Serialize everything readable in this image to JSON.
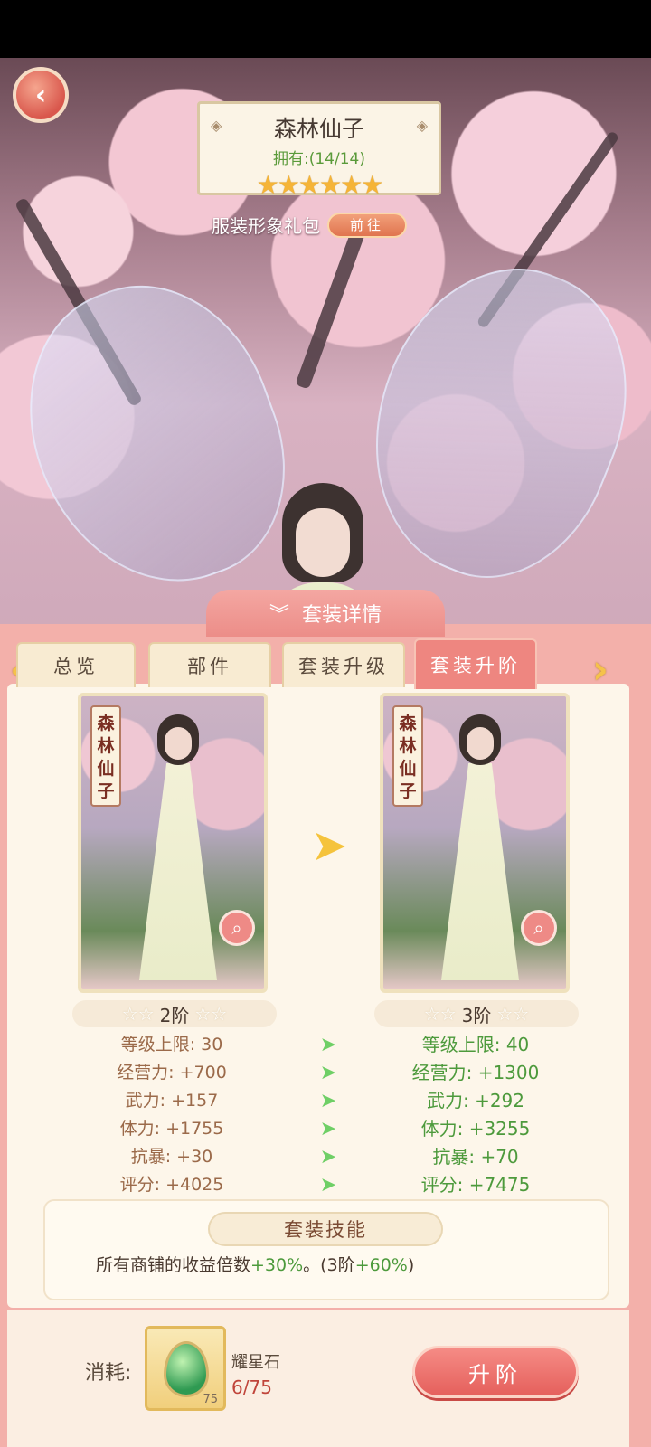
{
  "nameplate": {
    "title": "森林仙子",
    "owned": "拥有:(14/14)",
    "stars_filled": 6,
    "stars_glyphs": "★★★★★★"
  },
  "gift": {
    "label": "服装形象礼包",
    "button": "前往"
  },
  "panel": {
    "title": "套装详情"
  },
  "tabs": [
    {
      "label": "总览",
      "active": false
    },
    {
      "label": "部件",
      "active": false
    },
    {
      "label": "套装升级",
      "active": false
    },
    {
      "label": "套装升阶",
      "active": true
    }
  ],
  "cards": {
    "current": {
      "name_vertical": "森林仙子",
      "tier": "2阶"
    },
    "next": {
      "name_vertical": "森林仙子",
      "tier": "3阶"
    }
  },
  "stats": {
    "current": [
      "等级上限: 30",
      "经营力: +700",
      "武力: +157",
      "体力: +1755",
      "抗暴: +30",
      "评分: +4025"
    ],
    "next": [
      "等级上限: 40",
      "经营力: +1300",
      "武力: +292",
      "体力: +3255",
      "抗暴: +70",
      "评分: +7475"
    ]
  },
  "skill": {
    "title": "套装技能",
    "desc_prefix": "所有商铺的收益倍数",
    "desc_green": "+30%",
    "desc_mid": "。(3阶",
    "desc_green2": "+60%",
    "desc_suffix": ")"
  },
  "cost": {
    "label": "消耗:",
    "item_name": "耀星石",
    "item_count": "75",
    "progress": "6/75"
  },
  "upgrade_button": "升阶",
  "colors": {
    "accent": "#ee8680",
    "green": "#4d9a3c",
    "gold": "#f5b437"
  }
}
